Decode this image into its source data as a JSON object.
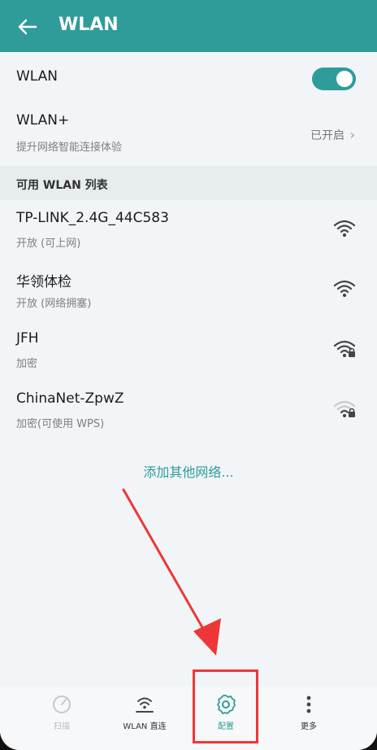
{
  "header": {
    "title": "WLAN"
  },
  "wlan_toggle": {
    "label": "WLAN",
    "state": "on"
  },
  "wlan_plus": {
    "title": "WLAN+",
    "subtitle": "提升网络智能连接体验",
    "status": "已开启"
  },
  "section": {
    "label": "可用 WLAN 列表"
  },
  "networks": [
    {
      "name": "TP-LINK_2.4G_44C583",
      "detail": "开放 (可上网)"
    },
    {
      "name": "华领体检",
      "detail": "开放 (网络拥塞)"
    },
    {
      "name": "JFH",
      "detail": "加密"
    },
    {
      "name": "ChinaNet-ZpwZ",
      "detail": "加密(可使用 WPS)"
    }
  ],
  "add_other": "添加其他网络...",
  "bottom": {
    "item1": "扫描",
    "item2": "WLAN 直连",
    "item3": "配置",
    "item4": "更多"
  },
  "colors": {
    "accent": "#2f9c9a",
    "annotation": "#ef3636"
  }
}
